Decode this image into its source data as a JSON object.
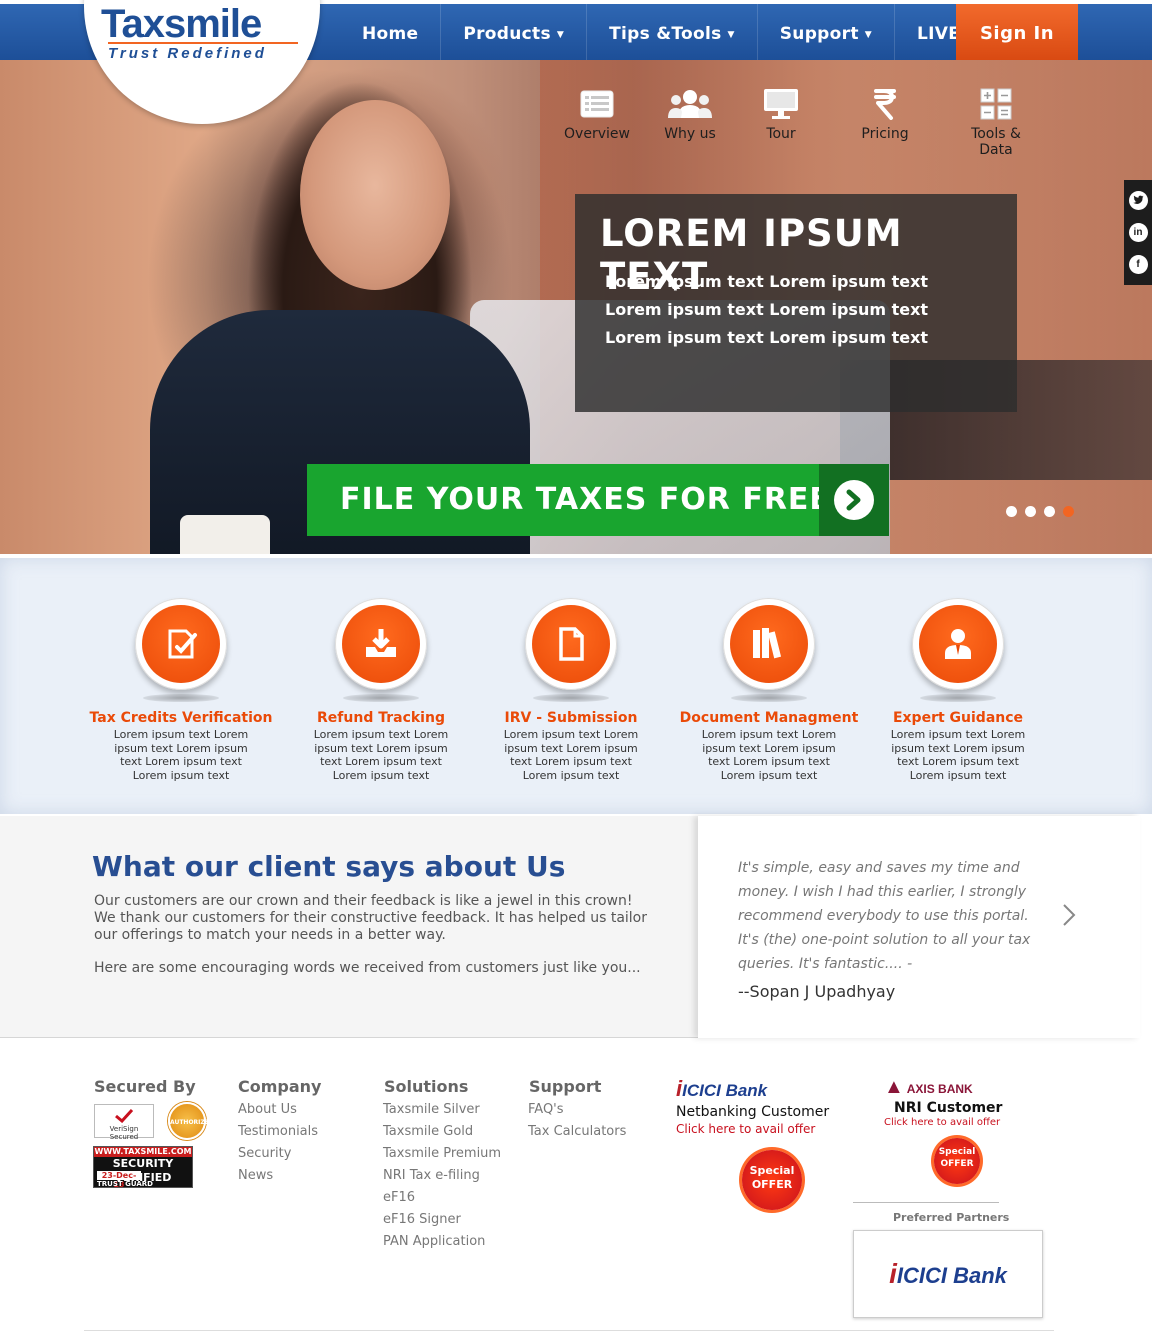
{
  "brand": {
    "name_part1": "Tax",
    "name_part2": "smile",
    "tagline": "Trust Redefined"
  },
  "nav": {
    "items": [
      {
        "label": "Home",
        "dropdown": false
      },
      {
        "label": "Products",
        "dropdown": true
      },
      {
        "label": "Tips &Tools",
        "dropdown": true
      },
      {
        "label": "Support",
        "dropdown": true
      },
      {
        "label": "LIVE CHAT",
        "dropdown": false
      }
    ],
    "sign_in": "Sign In"
  },
  "hero_menu": [
    {
      "label": "Overview",
      "icon": "list-icon"
    },
    {
      "label": "Why us",
      "icon": "group-icon"
    },
    {
      "label": "Tour",
      "icon": "monitor-icon"
    },
    {
      "label": "Pricing",
      "icon": "rupee-icon"
    },
    {
      "label": "Tools & Data",
      "icon": "calculator-icon"
    }
  ],
  "hero": {
    "title": "LOREM IPSUM TEXT",
    "text": "Lorem ipsum text Lorem ipsum text Lorem ipsum text Lorem ipsum text Lorem ipsum text Lorem ipsum text",
    "cta": "FILE YOUR TAXES FOR FREE",
    "slides": 4,
    "active_slide": 4
  },
  "social": [
    "twitter-icon",
    "linkedin-icon",
    "facebook-icon"
  ],
  "features": [
    {
      "title": "Tax Credits Verification",
      "text": "Lorem ipsum text Lorem ipsum text Lorem ipsum text Lorem ipsum text Lorem ipsum text",
      "icon": "edit-document-icon"
    },
    {
      "title": "Refund Tracking",
      "text": "Lorem ipsum text Lorem ipsum text Lorem ipsum text Lorem ipsum text Lorem ipsum text",
      "icon": "download-tray-icon"
    },
    {
      "title": "IRV - Submission",
      "text": "Lorem ipsum text Lorem ipsum text Lorem ipsum text Lorem ipsum text Lorem ipsum text",
      "icon": "file-icon"
    },
    {
      "title": "Document Managment",
      "text": "Lorem ipsum text Lorem ipsum text Lorem ipsum text Lorem ipsum text Lorem ipsum text",
      "icon": "books-icon"
    },
    {
      "title": "Expert Guidance",
      "text": "Lorem ipsum text Lorem ipsum text Lorem ipsum text Lorem ipsum text Lorem ipsum text",
      "icon": "expert-user-icon"
    }
  ],
  "testimonial": {
    "title": "What our client says about Us",
    "para1": "Our customers are our crown and their feedback is like a jewel in this crown! We thank our customers for their constructive feedback. It has helped us tailor our offerings to match your needs in a better way.",
    "para2": "Here are some encouraging words we received from customers just like you...",
    "quote": "It's simple, easy and saves my time and money. I wish I had this earlier, I strongly recommend everybody to use this portal. It's (the) one-point solution to all your tax queries. It's fantastic.... -",
    "author": "--Sopan J Upadhyay"
  },
  "footer": {
    "secured_by": "Secured By",
    "badges": {
      "verisign": "VeriSign Secured",
      "authorized": "AUTHORIZED",
      "security_url": "WWW.TAXSMILE.COM",
      "security_main": "SECURITY VERIFIED",
      "security_date": "23-Dec-13",
      "security_tg": "TRUST GUARD"
    },
    "company": {
      "title": "Company",
      "items": [
        "About Us",
        "Testimonials",
        "Security",
        "News"
      ]
    },
    "solutions": {
      "title": "Solutions",
      "items": [
        "Taxsmile Silver",
        "Taxsmile Gold",
        "Taxsmile Premium",
        "NRI Tax e-filing",
        "eF16",
        "eF16 Signer",
        "PAN Application"
      ]
    },
    "support": {
      "title": "Support",
      "items": [
        "FAQ's",
        "Tax Calculators"
      ]
    },
    "icici_offer": {
      "bank": "ICICI Bank",
      "sub": "Netbanking Customer",
      "click": "Click here to avail offer",
      "badge_line1": "Special",
      "badge_line2": "OFFER"
    },
    "axis_offer": {
      "bank": "AXIS BANK",
      "sub": "NRI Customer",
      "click": "Click here to avail offer",
      "badge_line1": "Special",
      "badge_line2": "OFFER"
    },
    "partners_title": "Preferred Partners",
    "partner_bank": "ICICI Bank"
  },
  "colors": {
    "nav_blue": "#1d4f98",
    "accent_orange": "#f26522",
    "cta_green": "#19a52f",
    "title_blue": "#284e92"
  }
}
